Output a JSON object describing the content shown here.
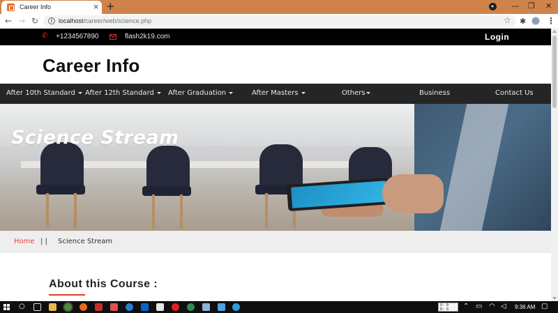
{
  "browser": {
    "tab_title": "Career Info",
    "tab_close": "×",
    "new_tab": "+",
    "url_host": "localhost",
    "url_path": "/career/web/science.php",
    "window_controls": {
      "minimize": "—",
      "maximize": "❐",
      "close": "✕"
    }
  },
  "topbar": {
    "phone": "+1234567890",
    "email": "flash2k19.com",
    "login": "Login"
  },
  "site": {
    "brand": "Career Info"
  },
  "nav": {
    "items": [
      {
        "label": "After 10th Standard",
        "dropdown": true
      },
      {
        "label": "After 12th Standard",
        "dropdown": true
      },
      {
        "label": "After Graduation",
        "dropdown": true
      },
      {
        "label": "After Masters",
        "dropdown": true
      },
      {
        "label": "Others",
        "dropdown": true
      },
      {
        "label": "Business",
        "dropdown": false
      },
      {
        "label": "Contact Us",
        "dropdown": false
      }
    ]
  },
  "hero": {
    "title": "Science Stream"
  },
  "breadcrumb": {
    "home": "Home",
    "separator": "| |",
    "current": "Science Stream"
  },
  "content": {
    "section_title": "About this Course :"
  },
  "taskbar": {
    "clock": "9:36 AM",
    "net_upload": "U: 0",
    "net_download": "D: 0"
  },
  "colors": {
    "accent_red": "#e2382c",
    "nav_bg": "#252525",
    "topbar_bg": "#000000",
    "tabstrip_bg": "#cf834a"
  }
}
